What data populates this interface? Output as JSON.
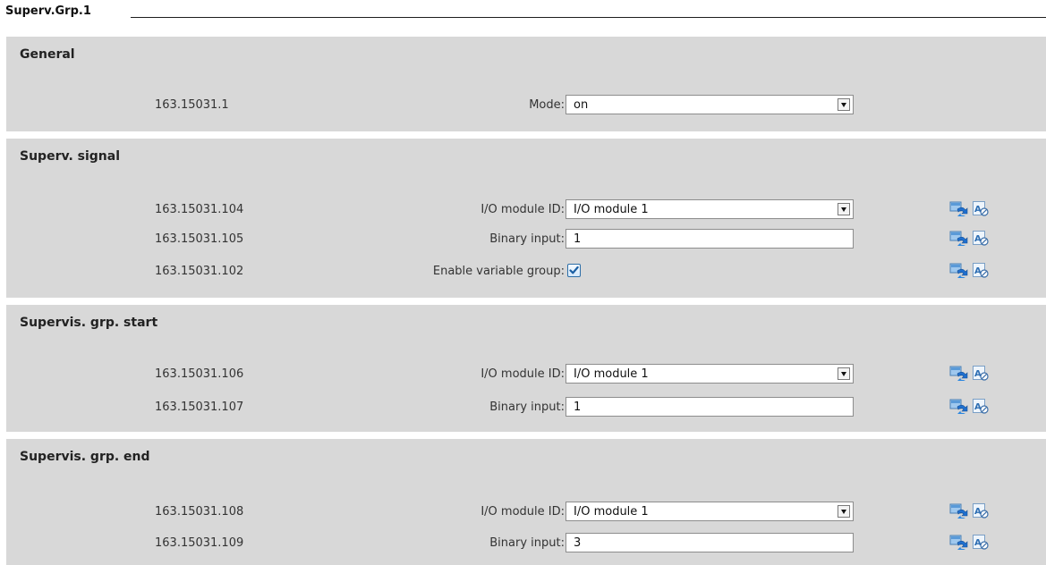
{
  "title": "Superv.Grp.1",
  "sections": [
    {
      "title": "General",
      "rows": [
        {
          "id": "163.15031.1",
          "label": "Mode:",
          "type": "select",
          "value": "on"
        }
      ]
    },
    {
      "title": "Superv. signal",
      "rows": [
        {
          "id": "163.15031.104",
          "label": "I/O module ID:",
          "type": "select",
          "value": "I/O module 1"
        },
        {
          "id": "163.15031.105",
          "label": "Binary input:",
          "type": "text",
          "value": "1"
        },
        {
          "id": "163.15031.102",
          "label": "Enable variable group:",
          "type": "checkbox",
          "checked": true
        }
      ]
    },
    {
      "title": "Supervis. grp. start",
      "rows": [
        {
          "id": "163.15031.106",
          "label": "I/O module ID:",
          "type": "select",
          "value": "I/O module 1"
        },
        {
          "id": "163.15031.107",
          "label": "Binary input:",
          "type": "text",
          "value": "1"
        }
      ]
    },
    {
      "title": "Supervis. grp. end",
      "rows": [
        {
          "id": "163.15031.108",
          "label": "I/O module ID:",
          "type": "select",
          "value": "I/O module 1"
        },
        {
          "id": "163.15031.109",
          "label": "Binary input:",
          "type": "text",
          "value": "3"
        }
      ]
    }
  ],
  "icons": {
    "row_action_1": "refresh-icon",
    "row_action_2": "text-disabled-icon"
  },
  "colors": {
    "section_bg": "#d8d8d8",
    "checkbox_check": "#1b5fa3",
    "icon_blue": "#2f7fd0"
  }
}
